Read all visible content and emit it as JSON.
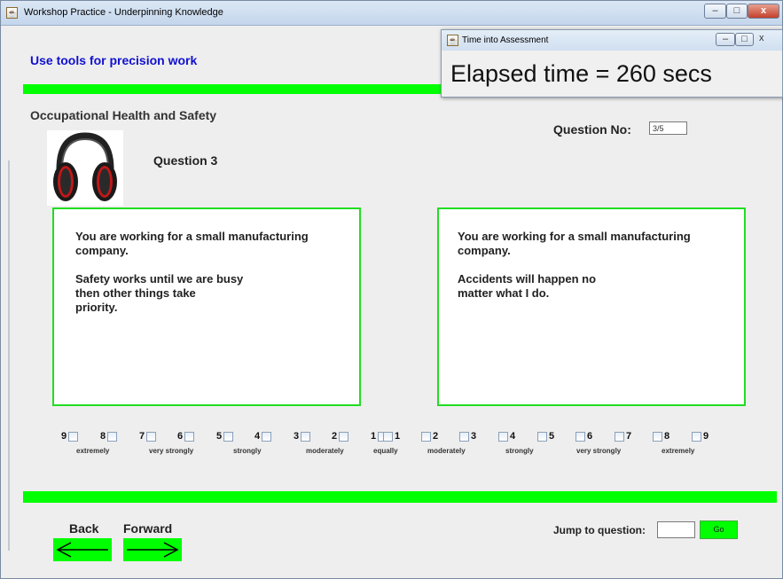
{
  "window": {
    "title": "Workshop Practice - Underpinning Knowledge",
    "minimize": "–",
    "maximize": "□",
    "close": "x"
  },
  "header": {
    "heading": "Use tools for precision work"
  },
  "section": {
    "title": "Occupational Health and Safety"
  },
  "question": {
    "number_label": "Question No:",
    "number_value": "3/5",
    "title": "Question 3",
    "image": "earmuffs-image"
  },
  "left_panel": {
    "lines": [
      "You are working for a small manufacturing",
      "company.",
      "",
      "Safety works until we are busy",
      "then other things take",
      "priority."
    ]
  },
  "right_panel": {
    "lines": [
      "You are working for a small manufacturing",
      "company.",
      "",
      "Accidents will happen no",
      "matter what I do."
    ]
  },
  "scale": {
    "items": [
      {
        "num": "9",
        "side": "left"
      },
      {
        "num": "8",
        "side": "left"
      },
      {
        "num": "7",
        "side": "left"
      },
      {
        "num": "6",
        "side": "left"
      },
      {
        "num": "5",
        "side": "left"
      },
      {
        "num": "4",
        "side": "left"
      },
      {
        "num": "3",
        "side": "left"
      },
      {
        "num": "2",
        "side": "left"
      },
      {
        "num": "1",
        "side": "left"
      },
      {
        "num": "1",
        "side": "right"
      },
      {
        "num": "2",
        "side": "right"
      },
      {
        "num": "3",
        "side": "right"
      },
      {
        "num": "4",
        "side": "right"
      },
      {
        "num": "5",
        "side": "right"
      },
      {
        "num": "6",
        "side": "right"
      },
      {
        "num": "7",
        "side": "right"
      },
      {
        "num": "8",
        "side": "right"
      },
      {
        "num": "9",
        "side": "right"
      }
    ],
    "labels": [
      "extremely",
      "very strongly",
      "strongly",
      "moderately",
      "equally",
      "moderately",
      "strongly",
      "very strongly",
      "extremely"
    ]
  },
  "nav": {
    "back_label": "Back",
    "forward_label": "Forward",
    "jump_label": "Jump to question:",
    "jump_value": "",
    "go_label": "Go"
  },
  "timer_window": {
    "title": "Time into Assessment",
    "text": "Elapsed time = 260 secs"
  },
  "colors": {
    "accent_green": "#00ff00",
    "heading_blue": "#1010d0"
  }
}
